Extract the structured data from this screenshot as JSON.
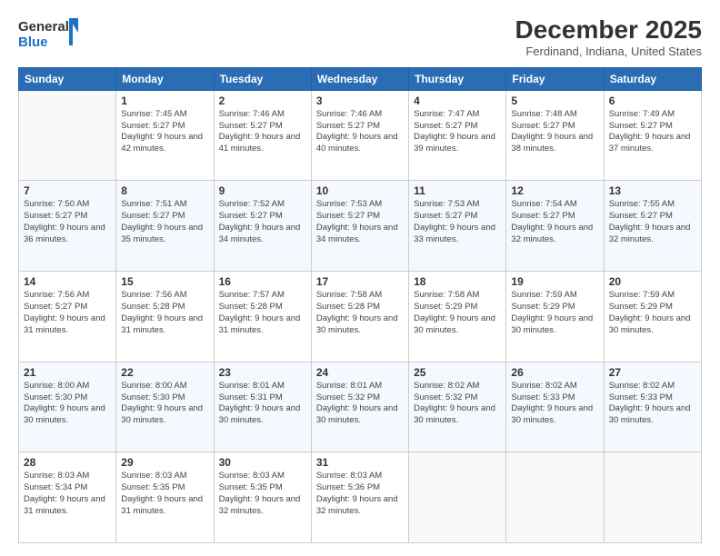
{
  "logo": {
    "line1": "General",
    "line2": "Blue"
  },
  "title": "December 2025",
  "subtitle": "Ferdinand, Indiana, United States",
  "days_of_week": [
    "Sunday",
    "Monday",
    "Tuesday",
    "Wednesday",
    "Thursday",
    "Friday",
    "Saturday"
  ],
  "weeks": [
    [
      {
        "day": "",
        "sunrise": "",
        "sunset": "",
        "daylight": ""
      },
      {
        "day": "1",
        "sunrise": "Sunrise: 7:45 AM",
        "sunset": "Sunset: 5:27 PM",
        "daylight": "Daylight: 9 hours and 42 minutes."
      },
      {
        "day": "2",
        "sunrise": "Sunrise: 7:46 AM",
        "sunset": "Sunset: 5:27 PM",
        "daylight": "Daylight: 9 hours and 41 minutes."
      },
      {
        "day": "3",
        "sunrise": "Sunrise: 7:46 AM",
        "sunset": "Sunset: 5:27 PM",
        "daylight": "Daylight: 9 hours and 40 minutes."
      },
      {
        "day": "4",
        "sunrise": "Sunrise: 7:47 AM",
        "sunset": "Sunset: 5:27 PM",
        "daylight": "Daylight: 9 hours and 39 minutes."
      },
      {
        "day": "5",
        "sunrise": "Sunrise: 7:48 AM",
        "sunset": "Sunset: 5:27 PM",
        "daylight": "Daylight: 9 hours and 38 minutes."
      },
      {
        "day": "6",
        "sunrise": "Sunrise: 7:49 AM",
        "sunset": "Sunset: 5:27 PM",
        "daylight": "Daylight: 9 hours and 37 minutes."
      }
    ],
    [
      {
        "day": "7",
        "sunrise": "Sunrise: 7:50 AM",
        "sunset": "Sunset: 5:27 PM",
        "daylight": "Daylight: 9 hours and 36 minutes."
      },
      {
        "day": "8",
        "sunrise": "Sunrise: 7:51 AM",
        "sunset": "Sunset: 5:27 PM",
        "daylight": "Daylight: 9 hours and 35 minutes."
      },
      {
        "day": "9",
        "sunrise": "Sunrise: 7:52 AM",
        "sunset": "Sunset: 5:27 PM",
        "daylight": "Daylight: 9 hours and 34 minutes."
      },
      {
        "day": "10",
        "sunrise": "Sunrise: 7:53 AM",
        "sunset": "Sunset: 5:27 PM",
        "daylight": "Daylight: 9 hours and 34 minutes."
      },
      {
        "day": "11",
        "sunrise": "Sunrise: 7:53 AM",
        "sunset": "Sunset: 5:27 PM",
        "daylight": "Daylight: 9 hours and 33 minutes."
      },
      {
        "day": "12",
        "sunrise": "Sunrise: 7:54 AM",
        "sunset": "Sunset: 5:27 PM",
        "daylight": "Daylight: 9 hours and 32 minutes."
      },
      {
        "day": "13",
        "sunrise": "Sunrise: 7:55 AM",
        "sunset": "Sunset: 5:27 PM",
        "daylight": "Daylight: 9 hours and 32 minutes."
      }
    ],
    [
      {
        "day": "14",
        "sunrise": "Sunrise: 7:56 AM",
        "sunset": "Sunset: 5:27 PM",
        "daylight": "Daylight: 9 hours and 31 minutes."
      },
      {
        "day": "15",
        "sunrise": "Sunrise: 7:56 AM",
        "sunset": "Sunset: 5:28 PM",
        "daylight": "Daylight: 9 hours and 31 minutes."
      },
      {
        "day": "16",
        "sunrise": "Sunrise: 7:57 AM",
        "sunset": "Sunset: 5:28 PM",
        "daylight": "Daylight: 9 hours and 31 minutes."
      },
      {
        "day": "17",
        "sunrise": "Sunrise: 7:58 AM",
        "sunset": "Sunset: 5:28 PM",
        "daylight": "Daylight: 9 hours and 30 minutes."
      },
      {
        "day": "18",
        "sunrise": "Sunrise: 7:58 AM",
        "sunset": "Sunset: 5:29 PM",
        "daylight": "Daylight: 9 hours and 30 minutes."
      },
      {
        "day": "19",
        "sunrise": "Sunrise: 7:59 AM",
        "sunset": "Sunset: 5:29 PM",
        "daylight": "Daylight: 9 hours and 30 minutes."
      },
      {
        "day": "20",
        "sunrise": "Sunrise: 7:59 AM",
        "sunset": "Sunset: 5:29 PM",
        "daylight": "Daylight: 9 hours and 30 minutes."
      }
    ],
    [
      {
        "day": "21",
        "sunrise": "Sunrise: 8:00 AM",
        "sunset": "Sunset: 5:30 PM",
        "daylight": "Daylight: 9 hours and 30 minutes."
      },
      {
        "day": "22",
        "sunrise": "Sunrise: 8:00 AM",
        "sunset": "Sunset: 5:30 PM",
        "daylight": "Daylight: 9 hours and 30 minutes."
      },
      {
        "day": "23",
        "sunrise": "Sunrise: 8:01 AM",
        "sunset": "Sunset: 5:31 PM",
        "daylight": "Daylight: 9 hours and 30 minutes."
      },
      {
        "day": "24",
        "sunrise": "Sunrise: 8:01 AM",
        "sunset": "Sunset: 5:32 PM",
        "daylight": "Daylight: 9 hours and 30 minutes."
      },
      {
        "day": "25",
        "sunrise": "Sunrise: 8:02 AM",
        "sunset": "Sunset: 5:32 PM",
        "daylight": "Daylight: 9 hours and 30 minutes."
      },
      {
        "day": "26",
        "sunrise": "Sunrise: 8:02 AM",
        "sunset": "Sunset: 5:33 PM",
        "daylight": "Daylight: 9 hours and 30 minutes."
      },
      {
        "day": "27",
        "sunrise": "Sunrise: 8:02 AM",
        "sunset": "Sunset: 5:33 PM",
        "daylight": "Daylight: 9 hours and 30 minutes."
      }
    ],
    [
      {
        "day": "28",
        "sunrise": "Sunrise: 8:03 AM",
        "sunset": "Sunset: 5:34 PM",
        "daylight": "Daylight: 9 hours and 31 minutes."
      },
      {
        "day": "29",
        "sunrise": "Sunrise: 8:03 AM",
        "sunset": "Sunset: 5:35 PM",
        "daylight": "Daylight: 9 hours and 31 minutes."
      },
      {
        "day": "30",
        "sunrise": "Sunrise: 8:03 AM",
        "sunset": "Sunset: 5:35 PM",
        "daylight": "Daylight: 9 hours and 32 minutes."
      },
      {
        "day": "31",
        "sunrise": "Sunrise: 8:03 AM",
        "sunset": "Sunset: 5:36 PM",
        "daylight": "Daylight: 9 hours and 32 minutes."
      },
      {
        "day": "",
        "sunrise": "",
        "sunset": "",
        "daylight": ""
      },
      {
        "day": "",
        "sunrise": "",
        "sunset": "",
        "daylight": ""
      },
      {
        "day": "",
        "sunrise": "",
        "sunset": "",
        "daylight": ""
      }
    ]
  ]
}
